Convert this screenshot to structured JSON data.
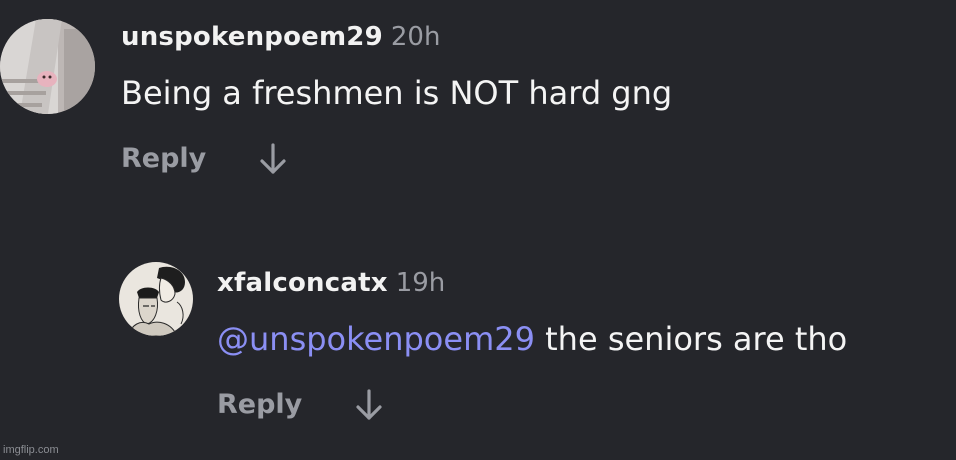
{
  "comments": [
    {
      "username": "unspokenpoem29",
      "time": "20h",
      "text": "Being a freshmen is NOT hard gng",
      "reply_label": "Reply",
      "avatar_icon": "avatar-photo-icon",
      "action_icon": "arrow-down-icon"
    },
    {
      "username": "xfalconcatx",
      "time": "19h",
      "mention": "@unspokenpoem29",
      "text": " the seniors are tho",
      "reply_label": "Reply",
      "avatar_icon": "avatar-manga-icon",
      "action_icon": "arrow-down-icon"
    }
  ],
  "watermark": "imgflip.com",
  "colors": {
    "background": "#25262b",
    "mention": "#8b8ff4",
    "muted": "#9a9ca3"
  }
}
